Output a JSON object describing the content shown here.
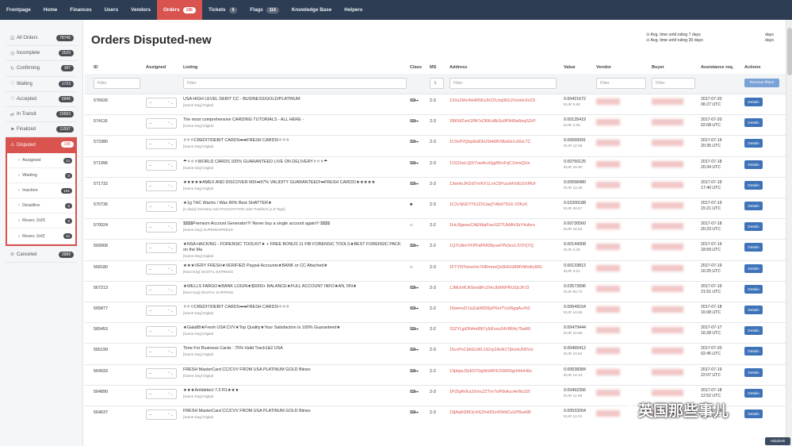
{
  "nav": [
    {
      "label": "Frontpage"
    },
    {
      "label": "Home"
    },
    {
      "label": "Finances"
    },
    {
      "label": "Users"
    },
    {
      "label": "Vendors"
    },
    {
      "label": "Orders",
      "badge": "196",
      "active": true
    },
    {
      "label": "Tickets",
      "badge": "0"
    },
    {
      "label": "Flags",
      "badge": "114"
    },
    {
      "label": "Knowledge Base"
    },
    {
      "label": "Helpers"
    }
  ],
  "sidebar": {
    "items": [
      {
        "label": "All Orders",
        "count": "78745",
        "icon": "check-icon"
      },
      {
        "label": "Incomplete",
        "count": "2529",
        "icon": "clock-icon"
      },
      {
        "label": "Confirming",
        "count": "187",
        "icon": "refresh-icon"
      },
      {
        "label": "Waiting",
        "count": "1723",
        "icon": "heart-icon"
      },
      {
        "label": "Accepted",
        "count": "5946",
        "icon": "heart-icon"
      },
      {
        "label": "In Transit",
        "count": "15563",
        "icon": "transit-icon"
      },
      {
        "label": "Finalized",
        "count": "11597",
        "icon": "flag-icon"
      },
      {
        "label": "Disputed",
        "count": "196",
        "icon": "warning-icon",
        "active": true
      }
    ],
    "sub_items": [
      {
        "label": "Assigned",
        "count": "14"
      },
      {
        "label": "Waiting",
        "count": "0"
      },
      {
        "label": "Inactive",
        "count": "161"
      },
      {
        "label": "Deadline",
        "count": "5"
      },
      {
        "label": "Resec 2of3",
        "count": "2"
      },
      {
        "label": "Resec 2of2",
        "count": "13"
      }
    ],
    "after": [
      {
        "label": "Canceled",
        "count": "3989",
        "icon": "cancel-icon"
      }
    ]
  },
  "page": {
    "title": "Orders Disputed-new",
    "legend_1": "Avg. time until ruling 7 days",
    "legend_2": "Avg. time until ruling 30 days",
    "legend_r1": "days",
    "legend_r2": "days"
  },
  "columns": {
    "id": "ID",
    "assigned": "Assigned",
    "listing": "Listing",
    "class": "Class",
    "ms": "MS",
    "address": "Address",
    "value": "Value",
    "vendor": "Vendor",
    "buyer": "Buyer",
    "assistance": "Assistance req.",
    "actions": "Actions"
  },
  "filters": {
    "placeholder": "Filter",
    "remove": "Remove filters"
  },
  "select_default": "--",
  "details_label": "Details",
  "rows": [
    {
      "id": "576626",
      "listing": "USA HIGH LEVEL DEBIT CC - BUSINESS/GOLD/PLATINUM",
      "sub": "[Same Day] Digital",
      "cls": "⌨⏭",
      "ms": "2-3",
      "addr": "13Xe2Wv4H4R5Kz9rZZUzqWGJVxxHzXn2S",
      "val": "0.00421672",
      "val_sub": "EUR 9.50",
      "date": "2017-07-20",
      "time": "06:27 UTC"
    },
    {
      "id": "574116",
      "listing": "The most comprehensive CARDING TUTORIALS - ALL HERE -",
      "sub": "[Same Day] Digital",
      "cls": "⌨⏭",
      "ms": "2-3",
      "addr": "1BKWZxnGPA7xDRKo8bSu9P849w5eqSZrP",
      "val": "0.00135419",
      "val_sub": "EUR 3.05",
      "date": "2017-07-20",
      "time": "02:08 UTC"
    },
    {
      "id": "573380",
      "listing": "⚪⚪⚪CREDIT/DEBIT CARDS➡➡FRESH CARDS!⚪⚪⚪",
      "sub": "[Same Day] Digital",
      "cls": "⌨⏭",
      "ms": "2-3",
      "addr": "1C9vP2Qbpt6dDHJSt4t9fV9brEb1vWxLTZ",
      "val": "0.00560091",
      "val_sub": "EUR 12.05",
      "date": "2017-07-19",
      "time": "20:35 UTC"
    },
    {
      "id": "571996",
      "listing": "☂⚪⚪⚪WORLD CARDS 100% GUARANTEED LIVE ON DELIVERY⚪⚪⚪☂",
      "sub": "[Same Day] Digital",
      "cls": "⌨⏭",
      "ms": "2-3",
      "addr": "11S31wLQtX7vwAcxGjgRKzFqC1rmsQUx",
      "val": "0.00750125",
      "val_sub": "EUR 16.90",
      "date": "2017-07-18",
      "time": "20:34 UTC"
    },
    {
      "id": "571732",
      "listing": "★★★★★AMEX AND DISCOVER MIX➡97% VALIDITY GUARANTEED!➡FRESH CARDS!★★★★★",
      "sub": "[Same Day] Digital",
      "cls": "⌨⏭",
      "ms": "2-3",
      "addr": "13wnfoJKDd7vVKF1LrvC5PuzvMVdGSXPEF",
      "val": "0.00598480",
      "val_sub": "EUR 13.48",
      "date": "2017-07-19",
      "time": "17:40 UTC"
    },
    {
      "id": "570736",
      "listing": "★1g THC Wachs / Wax 80% Best SHATTER★",
      "sub": "[2 days] Germany sub PACKSTATION oder Postfach [1,5 Tage]",
      "cls": "■",
      "ms": "2-3",
      "addr": "1C2vSKEYY6JZXUaqTH8zf73Gh X5Kz6",
      "val": "0.02200188",
      "val_sub": "EUR 49.57",
      "date": "2017-07-19",
      "time": "15:21 UTC"
    },
    {
      "id": "570024",
      "listing": "$$$$Premium Account Generator!!!! Never buy a single account again!!! $$$$",
      "sub": "[Same Day] SUPEREXPRESS",
      "cls": "▭",
      "ms": "2-2",
      "addr": "1HcJfgewvCAEMqrFwcGDTUkMhGbY4ufsro",
      "val": "0.00730560",
      "val_sub": "EUR 16.53",
      "date": "2017-07-18",
      "time": "20:23 UTC"
    },
    {
      "id": "569908",
      "listing": "★NSA HACKING - FORENSIC TOOLKIT★ + FREE BONUS 11 FBI FORENSIC TOOLS★BEST FORENSIC PACK on the Ma",
      "sub": "[Same Day] Digital",
      "cls": "⌨⏭",
      "ms": "2-2",
      "addr": "1Q7LfAmYFPFdPMD8yueFPk3vs1JV3YjYQ",
      "val": "0.00144308",
      "val_sub": "EUR 3.25",
      "date": "2017-07-19",
      "time": "18:59 UTC"
    },
    {
      "id": "568180",
      "listing": "★★★VERY FRESH★VERIFIED Paypal Accounts★BANK or CC Attached★",
      "sub": "[Next Day] DIGITAL EXPRESS",
      "cls": "▭",
      "ms": "2-3",
      "addr": "1FTYNTwxvrHv7HRmneQs9HGGBMVMmKzMG",
      "val": "0.00133813",
      "val_sub": "EUR 3.01",
      "date": "2017-07-19",
      "time": "16:25 UTC"
    },
    {
      "id": "567213",
      "listing": "★WELLS FARGO★BANK LOGIN★$5000+ BALANCE★FULL ACCOUNT INFO★AN, RN★",
      "sub": "[Next Day] DIGITAL SHIPPING",
      "cls": "⌨⏭",
      "ms": "2-3",
      "addr": "1JMckrfCASexdtFcZHoJbW6PRUZjcJFJ3",
      "val": "0.03573996",
      "val_sub": "EUR 80.73",
      "date": "2017-07-19",
      "time": "21:51 UTC"
    },
    {
      "id": "565877",
      "listing": "⚪⚪⚪CREDIT/DEBIT CARDS➡➡FRESH CARDS!⚪⚪⚪",
      "sub": "[Same Day] Digital",
      "cls": "⌨⏭",
      "ms": "2-2",
      "addr": "16wernZr1siZabMD6jxP6vt7Vs36gqAoJh3",
      "val": "0.00649154",
      "val_sub": "EUR 14.56",
      "date": "2017-07-18",
      "time": "16:08 UTC"
    },
    {
      "id": "565453",
      "listing": "★Gala88★Fresh USA CVV★Top Quality★Your Satisfaction Is 100% Guaranteed★",
      "sub": "[Same Day] Digital",
      "cls": "⌨⏭",
      "ms": "2-2",
      "addr": "15ZYLjpDN4m8f67y5iFxxo34V864y75wK6",
      "val": "0.00479444",
      "val_sub": "EUR 10.80",
      "date": "2017-07-17",
      "time": "16:28 UTC"
    },
    {
      "id": "565199",
      "listing": "Time For Business Cards : 75% Valid Track1&2 USA",
      "sub": "[Same Day] Digital",
      "cls": "⌨⏭",
      "ms": "2-3",
      "addr": "15vxPxCb6GcWL142rp2AsN1Tj9vmUN5Vcr",
      "val": "0.00465412",
      "val_sub": "EUR 10.84",
      "date": "2017-07-20",
      "time": "02:45 UTC"
    },
    {
      "id": "564933",
      "listing": "FRESH MasterCard CC/CVV FROM USA PLATINUM GOLD Biines",
      "sub": "[Same Day] Digital",
      "cls": "⌨⏭",
      "ms": "2-2",
      "addr": "13piqwJ3yE5TDgWsWF6JSW59grHHvH6o",
      "val": "0.00538384",
      "val_sub": "EUR 12.13",
      "date": "2017-07-19",
      "time": "22:07 UTC"
    },
    {
      "id": "564890",
      "listing": "★★★Antidetect 7.0 R1★★★",
      "sub": "[Same Day] Digital",
      "cls": "⌨⏭",
      "ms": "2-3",
      "addr": "1PZbjAVEa3XmxZZTm7nP6kAuc4eWs32t",
      "val": "0.00492356",
      "val_sub": "EUR 11.09",
      "date": "2017-07-18",
      "time": "12:52 UTC"
    },
    {
      "id": "564637",
      "listing": "FRESH MasterCard CC/CVV FROM USA PLATINUM GOLD Biines",
      "sub": "[Same Day] Digital",
      "cls": "⌨⏭",
      "ms": "2-3",
      "addr": "19jAqiN2MJyVrE2hH93s42MdCuUP8ue6B",
      "val": "0.00533264",
      "val_sub": "EUR 12.01",
      "date": "2017-07-18",
      "time": "16:27 UTC"
    }
  ],
  "watermark": "英国那些事儿",
  "helpdesk": "Helpdesk"
}
